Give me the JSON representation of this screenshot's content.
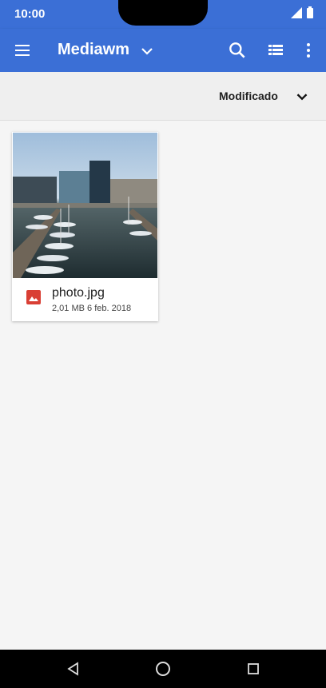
{
  "status_bar": {
    "time": "10:00",
    "icons": [
      "signal-icon",
      "battery-icon"
    ]
  },
  "app_bar": {
    "title": "Mediawm",
    "icons": [
      "menu-icon",
      "chevron-down-icon",
      "search-icon",
      "list-view-icon",
      "more-vert-icon"
    ],
    "color": "#3b6fd6"
  },
  "sort_bar": {
    "label": "Modificado",
    "icon": "chevron-down-icon"
  },
  "files": [
    {
      "name": "photo.jpg",
      "size": "2,01 MB",
      "date": "6 feb. 2018",
      "meta": "2,01 MB 6 feb. 2018",
      "type_icon": "image-file-icon",
      "type_icon_color": "#d93f34"
    }
  ],
  "nav_bar": {
    "icons": [
      "back-icon",
      "home-icon",
      "recents-icon"
    ]
  }
}
